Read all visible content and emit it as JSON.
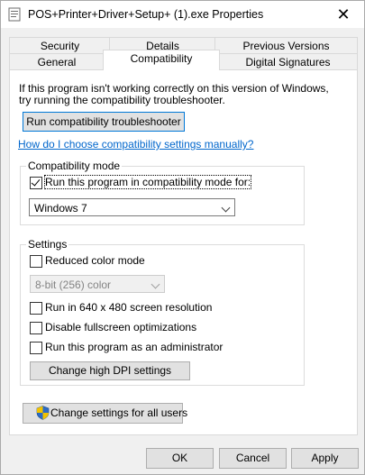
{
  "window": {
    "title": "POS+Printer+Driver+Setup+ (1).exe Properties",
    "close_glyph": "✕"
  },
  "tabs": {
    "back": [
      "Security",
      "Details",
      "Previous Versions"
    ],
    "front": [
      "General",
      "Compatibility",
      "Digital Signatures"
    ],
    "active": "Compatibility"
  },
  "intro": {
    "line1": "If this program isn't working correctly on this version of Windows,",
    "line2": "try running the compatibility troubleshooter."
  },
  "troubleshooter_button": "Run compatibility troubleshooter",
  "manual_link": "How do I choose compatibility settings manually?",
  "compat_mode": {
    "group_label": "Compatibility mode",
    "checkbox_label": "Run this program in compatibility mode for:",
    "checked": true,
    "selected_os": "Windows 7"
  },
  "settings": {
    "group_label": "Settings",
    "reduced_color": {
      "label": "Reduced color mode",
      "checked": false
    },
    "color_select": "8-bit (256) color",
    "res_640": {
      "label": "Run in 640 x 480 screen resolution",
      "checked": false
    },
    "fullscreen_opt": {
      "label": "Disable fullscreen optimizations",
      "checked": false
    },
    "admin": {
      "label": "Run this program as an administrator",
      "checked": false
    },
    "dpi_button": "Change high DPI settings"
  },
  "all_users_button": "Change settings for all users",
  "footer": {
    "ok": "OK",
    "cancel": "Cancel",
    "apply": "Apply"
  },
  "icons": {
    "title": "file-properties-icon",
    "shield": "uac-shield-icon",
    "close": "close-icon"
  },
  "colors": {
    "link": "#0066cc",
    "focus_border": "#0078d7",
    "button_bg": "#e1e1e1"
  }
}
